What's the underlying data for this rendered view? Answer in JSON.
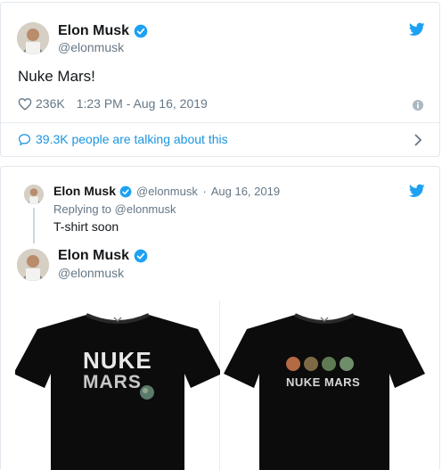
{
  "tweet1": {
    "author_name": "Elon Musk",
    "author_handle": "@elonmusk",
    "text": "Nuke Mars!",
    "likes": "236K",
    "timestamp": "1:23 PM - Aug 16, 2019",
    "talking": "39.3K people are talking about this"
  },
  "tweet2": {
    "reply": {
      "author_name": "Elon Musk",
      "author_handle": "@elonmusk",
      "date_sep": "·",
      "date": "Aug 16, 2019",
      "replying_to": "Replying to @elonmusk",
      "text": "T-shirt soon"
    },
    "author_name": "Elon Musk",
    "author_handle": "@elonmusk",
    "shirt1": {
      "line1": "NUKE",
      "line2": "MARS"
    },
    "shirt2": {
      "text": "NUKE MARS"
    }
  },
  "colors": {
    "accent": "#1da1f2",
    "link": "#1b95e0",
    "muted": "#657786"
  },
  "icons": [
    "twitter-bird-icon",
    "verified-badge-icon",
    "heart-icon",
    "info-icon",
    "speech-bubble-icon",
    "chevron-right-icon"
  ]
}
